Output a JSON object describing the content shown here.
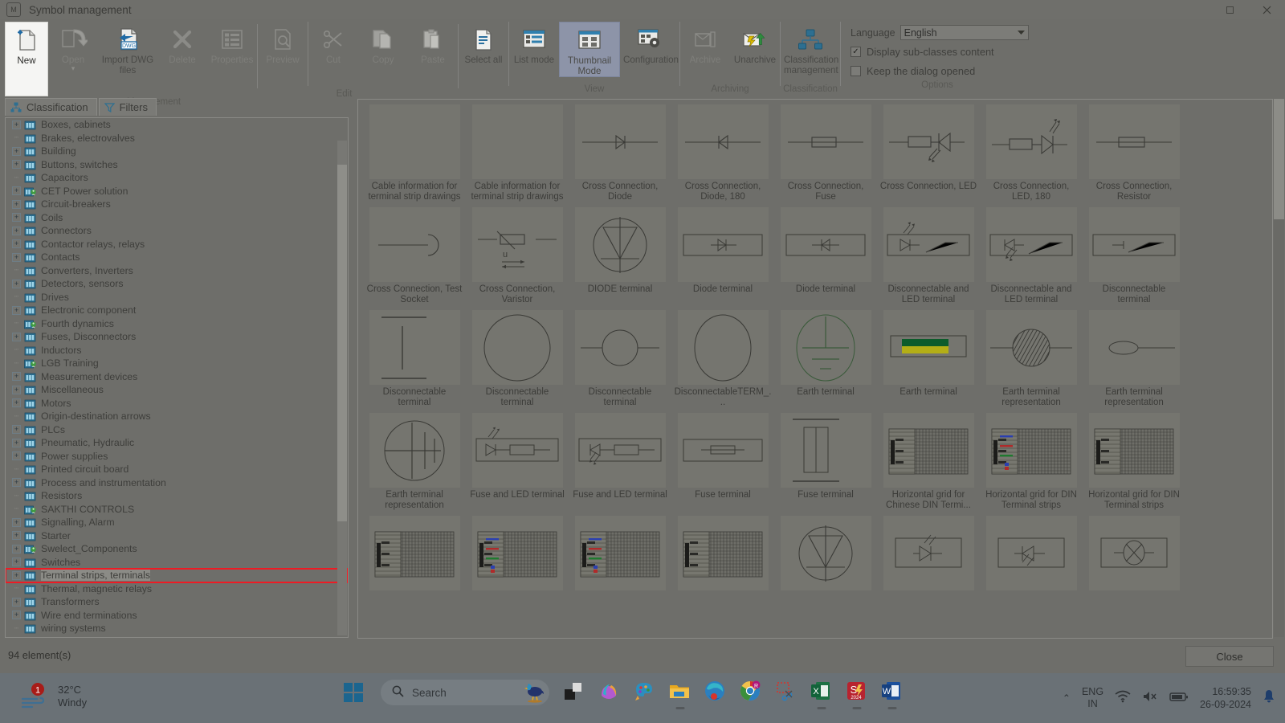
{
  "window": {
    "title": "Symbol management",
    "icon": "app-icon",
    "buttons": {
      "restore": "restore-icon",
      "close": "close-icon"
    }
  },
  "ribbon": {
    "groups": [
      {
        "name": "Management",
        "label": "Management",
        "items": [
          {
            "label": "New",
            "icon": "new-document-icon",
            "state": "active-panel"
          },
          {
            "label": "Open",
            "icon": "open-folder-icon",
            "state": "disabled",
            "has_dropdown": true
          },
          {
            "label": "Import DWG files",
            "icon": "import-dwg-icon",
            "state": "enabled"
          },
          {
            "label": "Delete",
            "icon": "delete-x-icon",
            "state": "disabled"
          },
          {
            "label": "Properties",
            "icon": "properties-list-icon",
            "state": "disabled"
          },
          {
            "label": "Preview",
            "icon": "preview-magnifier-icon",
            "state": "disabled"
          }
        ]
      },
      {
        "name": "Edit",
        "label": "Edit",
        "items": [
          {
            "label": "Cut",
            "icon": "scissors-icon",
            "state": "disabled"
          },
          {
            "label": "Copy",
            "icon": "copy-icon",
            "state": "disabled"
          },
          {
            "label": "Paste",
            "icon": "paste-icon",
            "state": "disabled"
          },
          {
            "label": "Select all",
            "icon": "select-all-icon",
            "state": "enabled"
          }
        ]
      },
      {
        "name": "View",
        "label": "View",
        "items": [
          {
            "label": "List mode",
            "icon": "list-mode-icon",
            "state": "enabled"
          },
          {
            "label": "Thumbnail Mode",
            "icon": "thumbnail-mode-icon",
            "state": "selected"
          },
          {
            "label": "Configuration",
            "icon": "configuration-gear-icon",
            "state": "enabled"
          }
        ]
      },
      {
        "name": "Archiving",
        "label": "Archiving",
        "items": [
          {
            "label": "Archive",
            "icon": "archive-icon",
            "state": "disabled"
          },
          {
            "label": "Unarchive",
            "icon": "unarchive-icon",
            "state": "enabled"
          }
        ]
      },
      {
        "name": "Classification",
        "label": "Classification",
        "items": [
          {
            "label": "Classification management",
            "icon": "classification-tree-icon",
            "state": "enabled"
          }
        ]
      }
    ],
    "options": {
      "label": "Options",
      "language_label": "Language",
      "language_value": "English",
      "checkboxes": [
        {
          "label": "Display sub-classes content",
          "checked": true
        },
        {
          "label": "Keep the dialog opened",
          "checked": false
        }
      ]
    }
  },
  "left_pane": {
    "tabs": [
      {
        "label": "Classification",
        "icon": "classification-icon",
        "selected": true
      },
      {
        "label": "Filters",
        "icon": "funnel-filter-icon",
        "selected": false
      }
    ],
    "tree": [
      {
        "label": "Boxes, cabinets",
        "expandable": true,
        "icon": "class-icon"
      },
      {
        "label": "Brakes, electrovalves",
        "expandable": false,
        "icon": "class-icon"
      },
      {
        "label": "Building",
        "expandable": true,
        "icon": "class-icon"
      },
      {
        "label": "Buttons, switches",
        "expandable": true,
        "icon": "class-icon"
      },
      {
        "label": "Capacitors",
        "expandable": false,
        "icon": "class-icon"
      },
      {
        "label": "CET Power solution",
        "expandable": true,
        "icon": "class-user-icon"
      },
      {
        "label": "Circuit-breakers",
        "expandable": true,
        "icon": "class-icon"
      },
      {
        "label": "Coils",
        "expandable": true,
        "icon": "class-icon"
      },
      {
        "label": "Connectors",
        "expandable": true,
        "icon": "class-icon"
      },
      {
        "label": "Contactor relays, relays",
        "expandable": true,
        "icon": "class-icon"
      },
      {
        "label": "Contacts",
        "expandable": true,
        "icon": "class-icon"
      },
      {
        "label": "Converters, Inverters",
        "expandable": false,
        "icon": "class-icon"
      },
      {
        "label": "Detectors, sensors",
        "expandable": true,
        "icon": "class-icon"
      },
      {
        "label": "Drives",
        "expandable": false,
        "icon": "class-icon"
      },
      {
        "label": "Electronic component",
        "expandable": true,
        "icon": "class-icon"
      },
      {
        "label": "Fourth dynamics",
        "expandable": false,
        "icon": "class-user-icon"
      },
      {
        "label": "Fuses, Disconnectors",
        "expandable": true,
        "icon": "class-icon"
      },
      {
        "label": "Inductors",
        "expandable": false,
        "icon": "class-icon"
      },
      {
        "label": "LGB Training",
        "expandable": false,
        "icon": "class-user-icon"
      },
      {
        "label": "Measurement devices",
        "expandable": true,
        "icon": "class-icon"
      },
      {
        "label": "Miscellaneous",
        "expandable": true,
        "icon": "class-icon"
      },
      {
        "label": "Motors",
        "expandable": true,
        "icon": "class-icon"
      },
      {
        "label": "Origin-destination arrows",
        "expandable": false,
        "icon": "class-icon"
      },
      {
        "label": "PLCs",
        "expandable": true,
        "icon": "class-icon"
      },
      {
        "label": "Pneumatic, Hydraulic",
        "expandable": true,
        "icon": "class-icon"
      },
      {
        "label": "Power supplies",
        "expandable": true,
        "icon": "class-icon"
      },
      {
        "label": "Printed circuit board",
        "expandable": false,
        "icon": "class-icon"
      },
      {
        "label": "Process and instrumentation",
        "expandable": true,
        "icon": "class-icon"
      },
      {
        "label": "Resistors",
        "expandable": false,
        "icon": "class-icon"
      },
      {
        "label": "SAKTHI CONTROLS",
        "expandable": false,
        "icon": "class-user-icon"
      },
      {
        "label": "Signalling, Alarm",
        "expandable": true,
        "icon": "class-icon"
      },
      {
        "label": "Starter",
        "expandable": true,
        "icon": "class-icon"
      },
      {
        "label": "Swelect_Components",
        "expandable": true,
        "icon": "class-user-icon"
      },
      {
        "label": "Switches",
        "expandable": true,
        "icon": "class-icon"
      },
      {
        "label": "Terminal strips, terminals",
        "expandable": true,
        "icon": "class-icon",
        "selected": true,
        "highlighted": true
      },
      {
        "label": "Thermal, magnetic relays",
        "expandable": false,
        "icon": "class-icon"
      },
      {
        "label": "Transformers",
        "expandable": true,
        "icon": "class-icon"
      },
      {
        "label": "Wire end terminations",
        "expandable": true,
        "icon": "class-icon"
      },
      {
        "label": "wiring systems",
        "expandable": false,
        "icon": "class-icon"
      }
    ]
  },
  "symbols": [
    {
      "label": "Cable information for terminal strip drawings",
      "glyph": "blank"
    },
    {
      "label": "Cable information for terminal strip drawings",
      "glyph": "blank"
    },
    {
      "label": "Cross Connection, Diode",
      "glyph": "diode-inline-right"
    },
    {
      "label": "Cross Connection, Diode, 180",
      "glyph": "diode-inline-left"
    },
    {
      "label": "Cross Connection, Fuse",
      "glyph": "fuse-inline"
    },
    {
      "label": "Cross Connection, LED",
      "glyph": "led-resistor-left"
    },
    {
      "label": "Cross Connection, LED, 180",
      "glyph": "led-resistor-right"
    },
    {
      "label": "Cross Connection, Resistor",
      "glyph": "resistor-inline"
    },
    {
      "label": "Cross Connection, Test Socket",
      "glyph": "test-socket"
    },
    {
      "label": "Cross Connection, Varistor",
      "glyph": "varistor"
    },
    {
      "label": "DIODE terminal",
      "glyph": "diode-circle"
    },
    {
      "label": "Diode terminal",
      "glyph": "diode-box-right"
    },
    {
      "label": "Diode terminal",
      "glyph": "diode-box-left"
    },
    {
      "label": "Disconnectable and LED terminal",
      "glyph": "led-disc-a"
    },
    {
      "label": "Disconnectable and LED terminal",
      "glyph": "led-disc-b"
    },
    {
      "label": "Disconnectable terminal",
      "glyph": "disc-box"
    },
    {
      "label": "Disconnectable terminal",
      "glyph": "bar-vertical"
    },
    {
      "label": "Disconnectable terminal",
      "glyph": "big-circle"
    },
    {
      "label": "Disconnectable terminal",
      "glyph": "small-circle-line"
    },
    {
      "label": "DisconnectableTERM_...",
      "glyph": "big-circle-wide"
    },
    {
      "label": "Earth terminal",
      "glyph": "earth-circle"
    },
    {
      "label": "Earth terminal",
      "glyph": "earth-green-yellow"
    },
    {
      "label": "Earth terminal representation",
      "glyph": "hatched-circle"
    },
    {
      "label": "Earth terminal representation",
      "glyph": "ellipse-line"
    },
    {
      "label": "Earth terminal representation",
      "glyph": "earth-cross-circle"
    },
    {
      "label": "Fuse and LED terminal",
      "glyph": "fuse-led-a"
    },
    {
      "label": "Fuse and LED terminal",
      "glyph": "fuse-led-b"
    },
    {
      "label": "Fuse terminal",
      "glyph": "fuse-box"
    },
    {
      "label": "Fuse terminal",
      "glyph": "fuse-vertical"
    },
    {
      "label": "Horizontal grid for Chinese DIN Termi...",
      "glyph": "grid-sheet-plain"
    },
    {
      "label": "Horizontal grid for DIN Terminal strips",
      "glyph": "grid-sheet-color"
    },
    {
      "label": "Horizontal grid for DIN Terminal strips",
      "glyph": "grid-sheet-plain"
    },
    {
      "label": "",
      "glyph": "grid-sheet-plain"
    },
    {
      "label": "",
      "glyph": "grid-sheet-color"
    },
    {
      "label": "",
      "glyph": "grid-sheet-color"
    },
    {
      "label": "",
      "glyph": "grid-sheet-plain"
    },
    {
      "label": "",
      "glyph": "diode-circle"
    },
    {
      "label": "",
      "glyph": "led-box-a"
    },
    {
      "label": "",
      "glyph": "led-box-b"
    },
    {
      "label": "",
      "glyph": "ellipse-cross-box"
    }
  ],
  "footer": {
    "status": "94 element(s)",
    "close_label": "Close"
  },
  "taskbar": {
    "weather": {
      "temperature": "32°C",
      "condition": "Windy",
      "badge": "1",
      "icon": "windy-icon"
    },
    "start": {
      "icon": "windows-logo-icon"
    },
    "search": {
      "placeholder": "Search",
      "icon": "search-icon",
      "mascot": "bird-mascot-icon"
    },
    "apps": [
      {
        "name": "task-view-icon",
        "running": false
      },
      {
        "name": "copilot-icon",
        "running": false
      },
      {
        "name": "paint-icon",
        "running": false
      },
      {
        "name": "file-explorer-icon",
        "running": true
      },
      {
        "name": "edge-icon",
        "running": false
      },
      {
        "name": "chrome-icon",
        "running": true
      },
      {
        "name": "snipping-tool-icon",
        "running": false
      },
      {
        "name": "excel-icon",
        "running": true
      },
      {
        "name": "solidworks-icon",
        "running": true
      },
      {
        "name": "word-icon",
        "running": true
      }
    ],
    "tray": {
      "chevron": "show-hidden-icons",
      "language_primary": "ENG",
      "language_secondary": "IN",
      "wifi": "wifi-icon",
      "volume": "volume-muted-icon",
      "battery": "battery-icon",
      "time": "16:59:35",
      "date": "26-09-2024",
      "notifications": "bell-icon"
    }
  },
  "colors": {
    "accent_blue": "#1b658f",
    "highlight_red": "#ee1b24",
    "selected_tab": "#8d94a8",
    "earth_green": "#0d5c2b",
    "earth_yellow": "#b3ae16"
  }
}
